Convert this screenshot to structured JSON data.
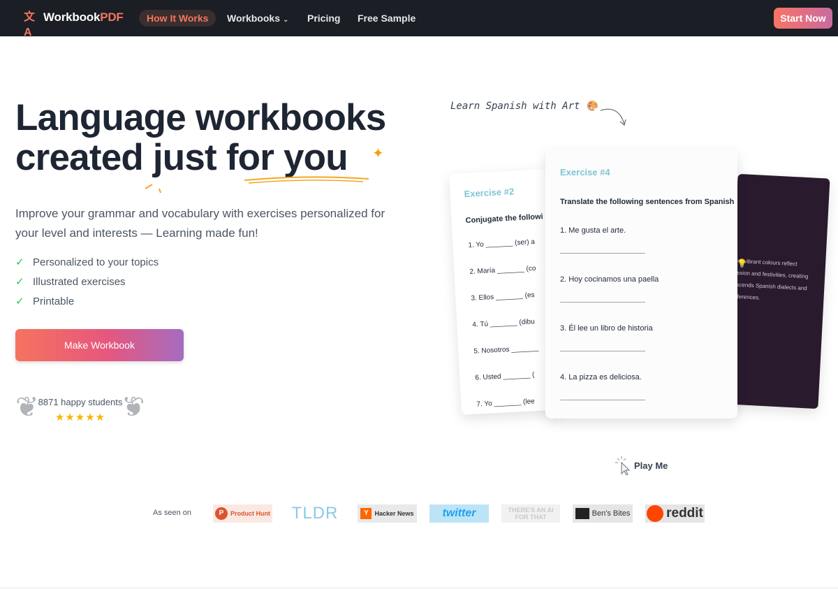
{
  "nav": {
    "brand_prefix": "Workbook",
    "brand_suffix": "PDF",
    "links": [
      {
        "label": "How It Works"
      },
      {
        "label": "Workbooks"
      },
      {
        "label": "Pricing"
      },
      {
        "label": "Free Sample"
      }
    ],
    "cta": "Start Now",
    "accent_color": "#f2765f"
  },
  "hero": {
    "title_line1": "Language workbooks",
    "title_line2": "created just for you",
    "subtitle": "Improve your grammar and vocabulary with exercises personalized for your level and interests — Learning made fun!",
    "features": [
      "Personalized to your topics",
      "Illustrated exercises",
      "Printable"
    ],
    "button": "Make Workbook",
    "students": "8871 happy students",
    "stars": "★★★★★"
  },
  "preview": {
    "caption": "Learn Spanish with Art 🎨",
    "card_back": {
      "title": "Exercise #2",
      "instruction": "Conjugate the followi",
      "items": [
        "1.  Yo _______ (ser) a",
        "2.  María _______ (co",
        "3.  Ellos _______ (es",
        "4.  Tú _______ (dibu",
        "5.  Nosotros _______",
        "6.  Usted _______ (",
        "7.  Yo _______ (lee"
      ]
    },
    "card_front": {
      "title": "Exercise #4",
      "instruction": "Translate the following sentences from Spanish",
      "items": [
        "1.  Me gusta el arte.",
        "2.  Hoy cocinamos una paella",
        "3.  Él lee un libro de historia",
        "4.  La pizza es deliciosa."
      ]
    },
    "card_dark_text": [
      "rt, vibrant colours reflect",
      "ssion and festivities, creating",
      "scends Spanish dialects and",
      "fferences."
    ],
    "play_label": "Play Me"
  },
  "press": {
    "label": "As seen on",
    "logos": {
      "producthunt": "Product Hunt",
      "tldr": "TLDR",
      "hackernews": "Hacker News",
      "twitter": "twitter",
      "aiforthat": "THERE'S AN AI FOR THAT",
      "bensbites": "Ben's Bites",
      "reddit": "reddit"
    }
  }
}
